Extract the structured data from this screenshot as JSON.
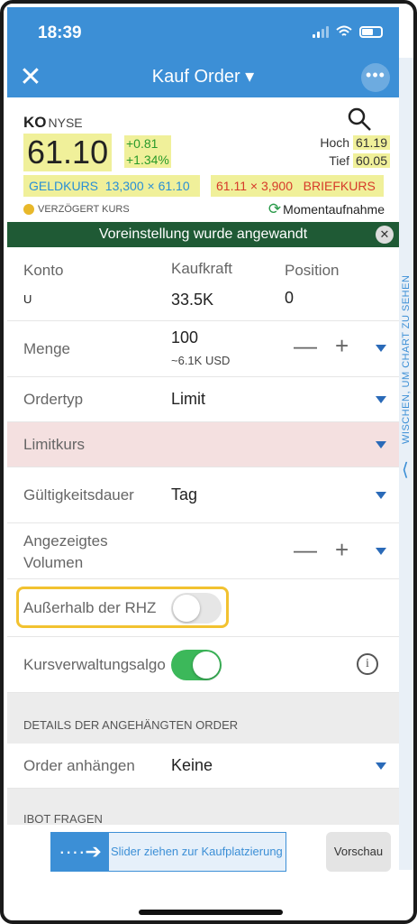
{
  "status": {
    "time": "18:39"
  },
  "nav": {
    "title": "Kauf Order ▾",
    "close": "✕",
    "more": "•••"
  },
  "quote": {
    "symbol": "KO",
    "exchange": "NYSE",
    "price": "61.10",
    "change": "+0.81",
    "change_pct": "+1.34%",
    "high_label": "Hoch",
    "high": "61.19",
    "low_label": "Tief",
    "low": "60.05",
    "bid": "GELDKURS  13,300 × 61.10",
    "ask": "61.11 × 3,900   BRIEFKURS",
    "delayed": "VERZÖGERT KURS",
    "snapshot": "Momentaufnahme"
  },
  "banner": {
    "text": "Voreinstellung wurde angewandt",
    "close": "✕"
  },
  "side": {
    "text": "WISCHEN, UM CHART ZU SEHEN",
    "chevron": "⟨"
  },
  "account": {
    "konto_label": "Konto",
    "konto_value": "U",
    "kaufkraft_label": "Kaufkraft",
    "kaufkraft_value": "33.5K",
    "position_label": "Position",
    "position_value": "0"
  },
  "menge": {
    "label": "Menge",
    "value": "100",
    "sub": "~6.1K USD",
    "minus": "—",
    "plus": "+"
  },
  "ordertyp": {
    "label": "Ordertyp",
    "value": "Limit"
  },
  "limitkurs": {
    "label": "Limitkurs"
  },
  "gueltigkeit": {
    "label": "Gültigkeitsdauer",
    "value": "Tag"
  },
  "volumen": {
    "label_line1": "Angezeigtes",
    "label_line2": "Volumen",
    "minus": "—",
    "plus": "+"
  },
  "rhz": {
    "label": "Außerhalb der RHZ",
    "on": false
  },
  "algo": {
    "label": "Kursverwaltungsalgo",
    "on": true,
    "info": "i"
  },
  "details_section": {
    "label": "DETAILS DER ANGEHÄNGTEN ORDER"
  },
  "anhaengen": {
    "label": "Order anhängen",
    "value": "Keine"
  },
  "ibot_section": {
    "label": "IBOT FRAGEN"
  },
  "bottom": {
    "slider_text": "Slider ziehen zur Kaufplatzierung",
    "slider_handle": "····➔",
    "preview": "Vorschau"
  },
  "colors": {
    "accent": "#3c8fd6",
    "toggle_on": "#3cb85a",
    "banner": "#1f5a35",
    "limit_bg": "#f4e0e0"
  }
}
